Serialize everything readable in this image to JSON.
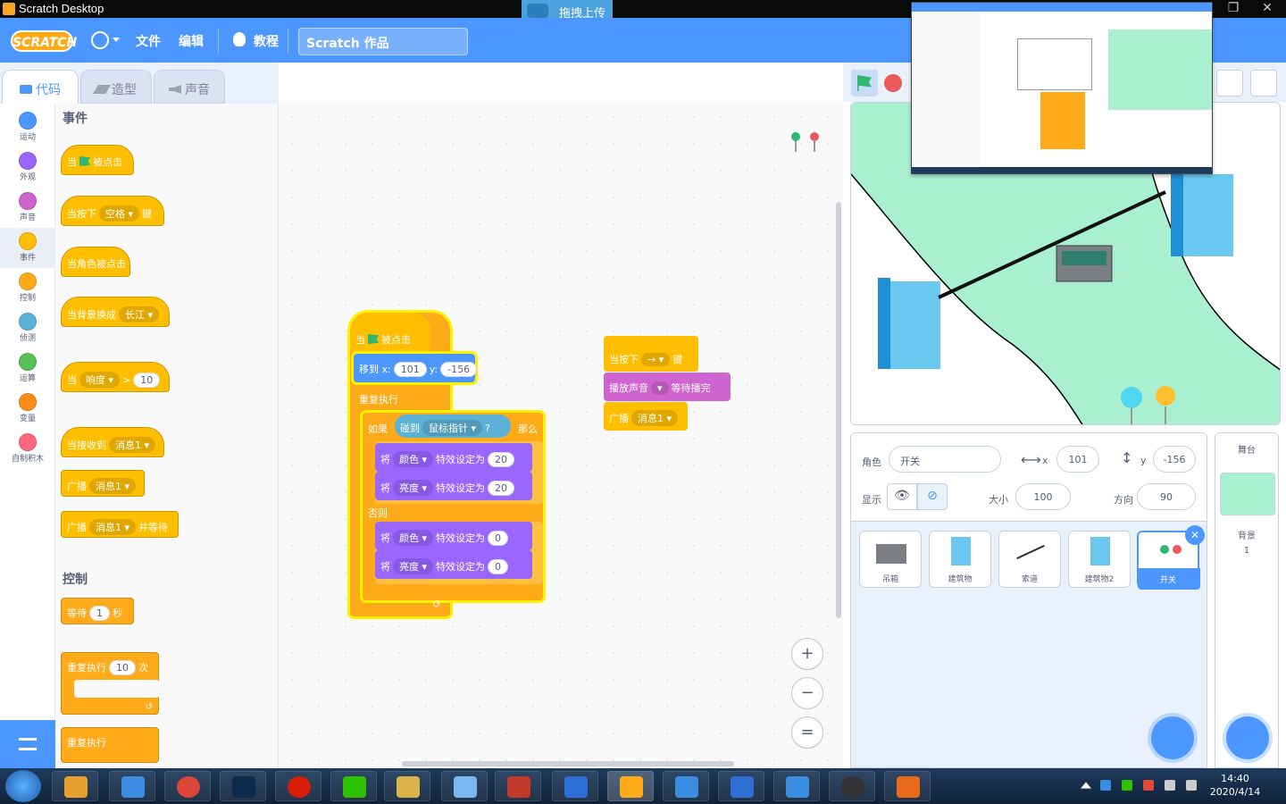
{
  "window": {
    "title": "Scratch Desktop",
    "upload_label": "拖拽上传"
  },
  "menubar": {
    "logo": "SCRATCH",
    "file": "文件",
    "edit": "编辑",
    "tutorials": "教程",
    "project_title": "Scratch 作品"
  },
  "tabs": [
    {
      "label": "代码"
    },
    {
      "label": "造型"
    },
    {
      "label": "声音"
    }
  ],
  "categories": [
    {
      "label": "运动",
      "color": "#4c97ff"
    },
    {
      "label": "外观",
      "color": "#9966ff"
    },
    {
      "label": "声音",
      "color": "#cf63cf"
    },
    {
      "label": "事件",
      "color": "#ffbf00"
    },
    {
      "label": "控制",
      "color": "#ffab19"
    },
    {
      "label": "侦测",
      "color": "#5cb1d6"
    },
    {
      "label": "运算",
      "color": "#59c059"
    },
    {
      "label": "变量",
      "color": "#ff8c1a"
    },
    {
      "label": "自制积木",
      "color": "#ff6680"
    }
  ],
  "palette": {
    "events_title": "事件",
    "control_title": "控制",
    "b_flag_a": "当",
    "b_flag_b": "被点击",
    "b_key_a": "当按下",
    "b_key_slot": "空格",
    "b_key_b": "键",
    "b_sprite_clicked": "当角色被点击",
    "b_backdrop_a": "当背景换成",
    "b_backdrop_slot": "长江",
    "b_gt_a": "当",
    "b_gt_slot": "响度",
    "b_gt_op": ">",
    "b_gt_val": "10",
    "b_recv_a": "当接收到",
    "b_recv_slot": "消息1",
    "b_bc_a": "广播",
    "b_bc_slot": "消息1",
    "b_bcw_a": "广播",
    "b_bcw_slot": "消息1",
    "b_bcw_b": "并等待",
    "b_wait_a": "等待",
    "b_wait_val": "1",
    "b_wait_b": "秒",
    "b_rep_a": "重复执行",
    "b_rep_val": "10",
    "b_rep_b": "次",
    "b_forever": "重复执行"
  },
  "script1": {
    "hat_a": "当",
    "hat_b": "被点击",
    "goto_a": "移到 x:",
    "goto_x": "101",
    "goto_b": "y:",
    "goto_y": "-156",
    "forever": "重复执行",
    "if_a": "如果",
    "if_touch": "碰到",
    "if_slot": "鼠标指针",
    "if_q": "?",
    "if_b": "那么",
    "set": "将",
    "color": "颜色",
    "bright": "亮度",
    "effect": "特效设定为",
    "v20": "20",
    "v0": "0",
    "else": "否则"
  },
  "script2": {
    "hat_a": "当按下",
    "hat_slot": "→",
    "hat_b": "键",
    "play_a": "播放声音",
    "play_b": "等待播完",
    "bc_a": "广播",
    "bc_slot": "消息1"
  },
  "zoom": {
    "in": "+",
    "out": "−",
    "reset": "="
  },
  "sprite_info": {
    "sprite_label": "角色",
    "sprite_name": "开关",
    "x_label": "x",
    "x": "101",
    "y_label": "y",
    "y": "-156",
    "show_label": "显示",
    "size_label": "大小",
    "size": "100",
    "dir_label": "方向",
    "dir": "90"
  },
  "sprites": [
    {
      "name": "吊箱"
    },
    {
      "name": "建筑物"
    },
    {
      "name": "索道"
    },
    {
      "name": "建筑物2"
    },
    {
      "name": "开关"
    }
  ],
  "stage_panel": {
    "title": "舞台",
    "backdrop_label": "背景",
    "backdrop_count": "1"
  },
  "clock": {
    "time": "14:40",
    "date": "2020/4/14"
  }
}
